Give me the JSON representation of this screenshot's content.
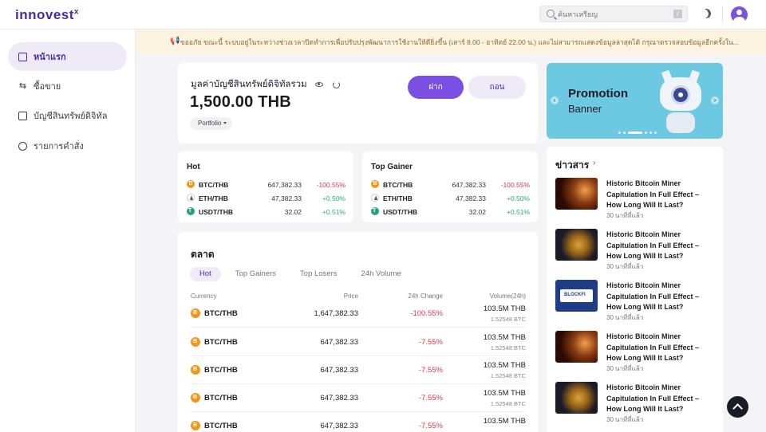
{
  "header": {
    "logo_main": "innovest",
    "logo_super": "x",
    "search_placeholder": "ค้นหาเหรียญ",
    "search_kbd": "/"
  },
  "sidebar": {
    "items": [
      {
        "label": "หน้าแรก",
        "active": true
      },
      {
        "label": "ซื้อขาย",
        "active": false
      },
      {
        "label": "บัญชีสินทรัพย์ดิจิทัล",
        "active": false
      },
      {
        "label": "รายการคำสั่ง",
        "active": false
      }
    ]
  },
  "notice": {
    "text": "ขออภัย ขณะนี้ ระบบอยู่ในระหว่างช่วงเวลาปิดทำการเพื่อปรับปรุงพัฒนาการใช้งานให้ดียิ่งขึ้น (เสาร์ 8.00 - อาทิตย์ 22.00 น.) และไม่สามารถแสดงข้อมูลล่าสุดได้ กรุณาตรวจสอบข้อมูลอีกครั้งใน..."
  },
  "balance": {
    "label": "มูลค่าบัญชีสินทรัพย์ดิจิทัลรวม",
    "value": "1,500.00 THB",
    "portfolio": "Portfolio",
    "deposit": "ฝาก",
    "withdraw": "ถอน"
  },
  "hot": {
    "title": "Hot",
    "rows": [
      {
        "symbol": "BTC/THB",
        "price": "647,382.33",
        "change": "-100.55%"
      },
      {
        "symbol": "ETH/THB",
        "price": "47,382.33",
        "change": "+0.50%"
      },
      {
        "symbol": "USDT/THB",
        "price": "32.02",
        "change": "+0.51%"
      }
    ]
  },
  "gainer": {
    "title": "Top Gainer",
    "rows": [
      {
        "symbol": "BTC/THB",
        "price": "647,382.33",
        "change": "-100.55%"
      },
      {
        "symbol": "ETH/THB",
        "price": "47,382.33",
        "change": "+0.50%"
      },
      {
        "symbol": "USDT/THB",
        "price": "32.02",
        "change": "+0.51%"
      }
    ]
  },
  "market": {
    "title": "ตลาด",
    "tabs": [
      "Hot",
      "Top Gainers",
      "Top Losers",
      "24h Volume"
    ],
    "columns": {
      "currency": "Currency",
      "price": "Price",
      "change": "24h Change",
      "volume": "Volume(24h)"
    },
    "rows": [
      {
        "symbol": "BTC/THB",
        "price": "1,647,382.33",
        "change": "-100.55%",
        "volume": "103.5M THB",
        "volume_btc": "1.52548 BTC"
      },
      {
        "symbol": "BTC/THB",
        "price": "647,382.33",
        "change": "-7.55%",
        "volume": "103.5M THB",
        "volume_btc": "1.52548 BTC"
      },
      {
        "symbol": "BTC/THB",
        "price": "647,382.33",
        "change": "-7.55%",
        "volume": "103.5M THB",
        "volume_btc": "1.52548 BTC"
      },
      {
        "symbol": "BTC/THB",
        "price": "647,382.33",
        "change": "-7.55%",
        "volume": "103.5M THB",
        "volume_btc": "1.52548 BTC"
      },
      {
        "symbol": "BTC/THB",
        "price": "647,382.33",
        "change": "-7.55%",
        "volume": "103.5M THB",
        "volume_btc": ""
      }
    ]
  },
  "banner": {
    "line1": "Promotion",
    "line2": "Banner"
  },
  "news": {
    "title": "ข่าวสาร",
    "items": [
      {
        "headline": "Historic Bitcoin Miner Capitulation In Full Effect – How Long Will It Last?",
        "time": "30 นาทีที่แล้ว"
      },
      {
        "headline": "Historic Bitcoin Miner Capitulation In Full Effect – How Long Will It Last?",
        "time": "30 นาทีที่แล้ว"
      },
      {
        "headline": "Historic Bitcoin Miner Capitulation In Full Effect – How Long Will It Last?",
        "time": "30 นาทีที่แล้ว"
      },
      {
        "headline": "Historic Bitcoin Miner Capitulation In Full Effect – How Long Will It Last?",
        "time": "30 นาทีที่แล้ว"
      },
      {
        "headline": "Historic Bitcoin Miner Capitulation In Full Effect – How Long Will It Last?",
        "time": "30 นาทีที่แล้ว"
      }
    ]
  },
  "colors": {
    "brand": "#4b2aa8",
    "accent": "#7b4fe2",
    "negative": "#e0364b",
    "positive": "#23b26b"
  }
}
